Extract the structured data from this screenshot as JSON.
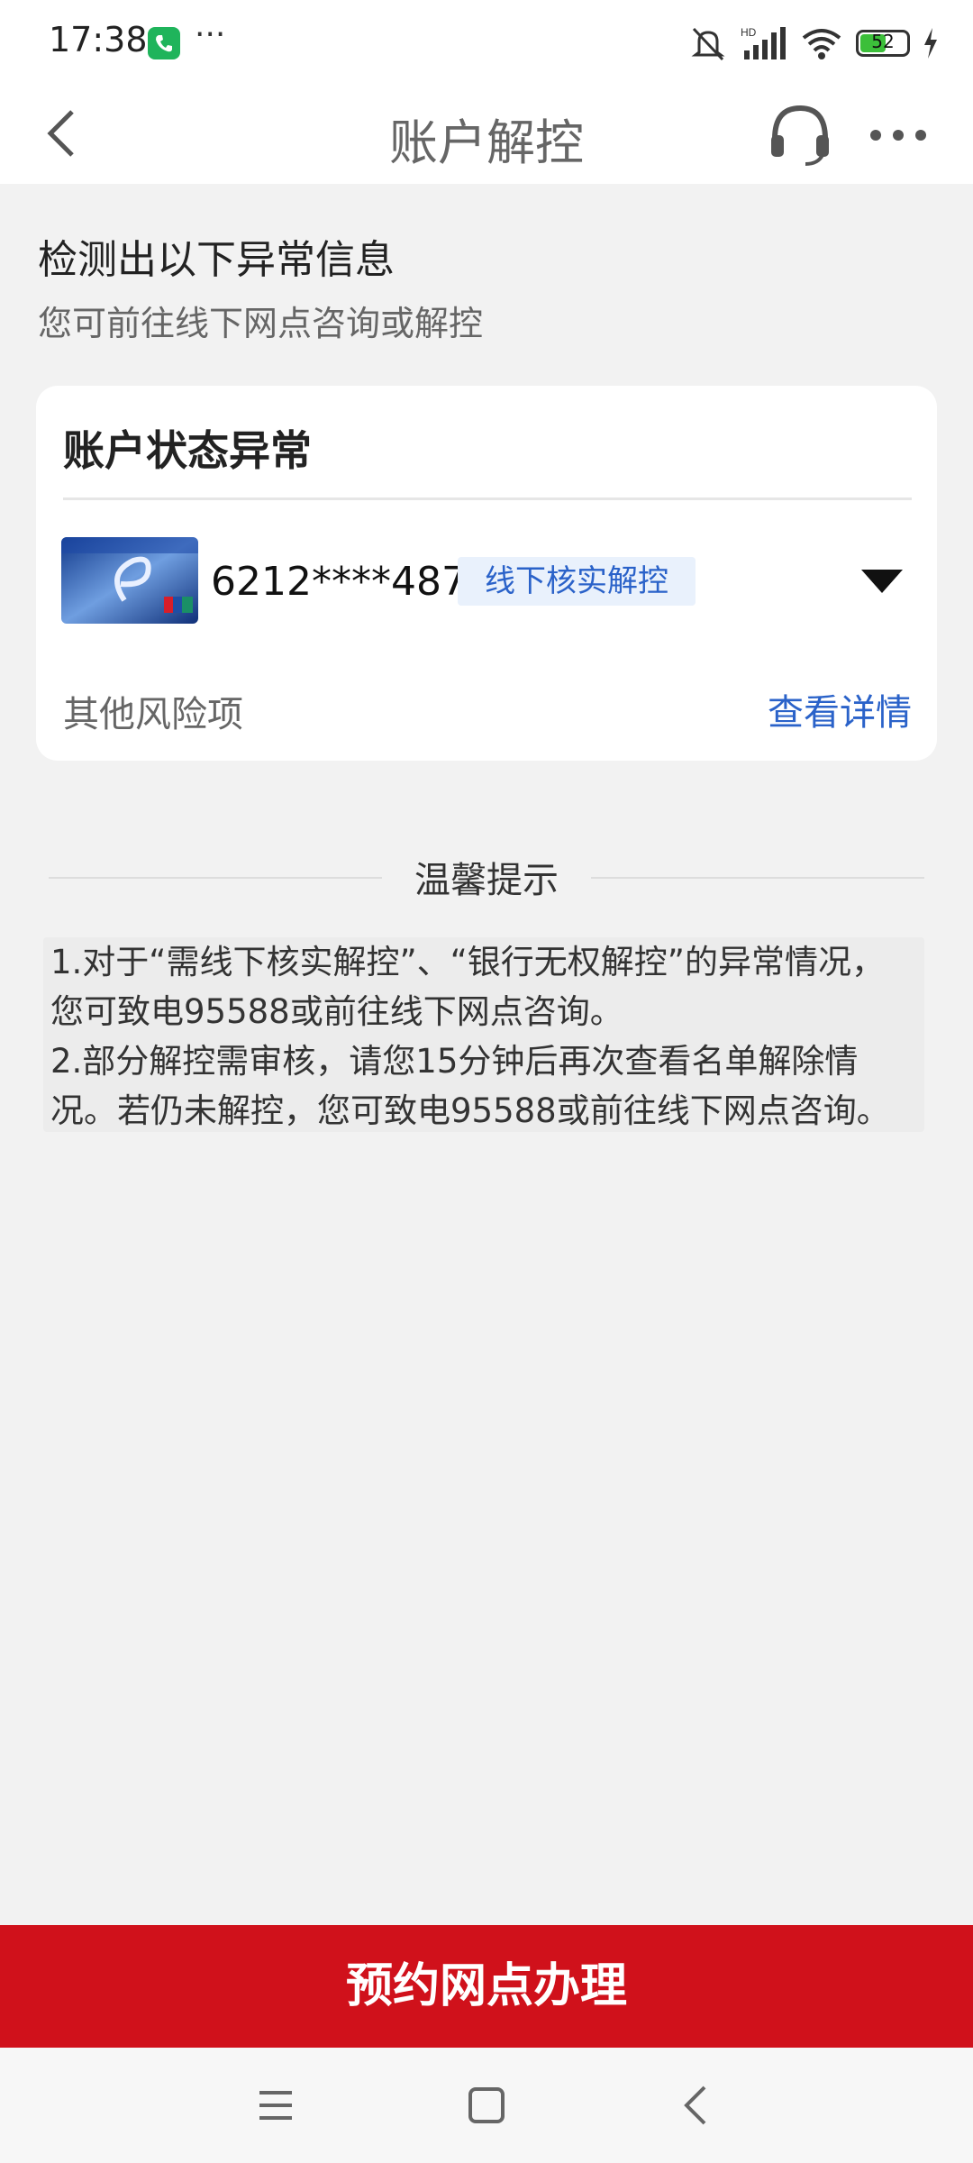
{
  "status_bar": {
    "time": "17:38",
    "dots": "···",
    "battery": "52",
    "icons": [
      "phone-icon",
      "mute-icon",
      "signal-icon",
      "wifi-icon",
      "battery-icon",
      "charging-icon"
    ]
  },
  "nav": {
    "title": "账户解控",
    "icons": [
      "back-icon",
      "headset-icon",
      "more-icon"
    ]
  },
  "intro": {
    "title": "检测出以下异常信息",
    "subtitle": "您可前往线下网点咨询或解控"
  },
  "card": {
    "title": "账户状态异常",
    "account_number": "6212****4873",
    "status_tag": "线下核实解控",
    "other_risk_label": "其他风险项",
    "view_details": "查看详情"
  },
  "tips": {
    "title": "温馨提示",
    "item_1": "1.对于“需线下核实解控”、“银行无权解控”的异常情况，您可致电95588或前往线下网点咨询。",
    "item_2": "2.部分解控需审核，请您15分钟后再次查看名单解除情况。若仍未解控，您可致电95588或前往线下网点咨询。"
  },
  "bottom": {
    "button_label": "预约网点办理"
  },
  "colors": {
    "primary_red": "#d0111b",
    "link_blue": "#2a62c9",
    "tag_bg": "#e9f1fc",
    "page_bg": "#f2f2f2"
  }
}
